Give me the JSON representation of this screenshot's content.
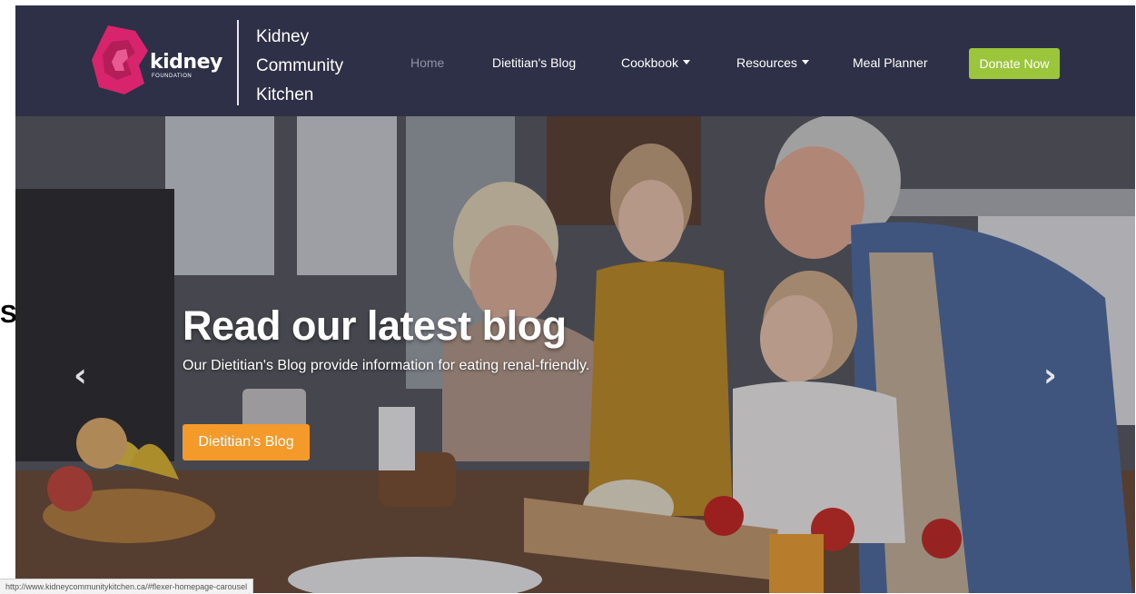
{
  "logo": {
    "word": "kidney",
    "sub": "FOUNDATION",
    "mark_color": "#d8246c"
  },
  "brand": {
    "line1": "Kidney",
    "line2": "Community",
    "line3": "Kitchen"
  },
  "nav": {
    "home": "Home",
    "blog": "Dietitian's Blog",
    "cookbook": "Cookbook",
    "resources": "Resources",
    "meal_planner": "Meal Planner",
    "donate": "Donate Now"
  },
  "hero": {
    "title": "Read our latest blog",
    "subtitle": "Our Dietitian's Blog provide information for eating renal-friendly.",
    "cta": "Dietitian's Blog",
    "prev_icon": "chevron-left-icon",
    "next_icon": "chevron-right-icon"
  },
  "status_url": "http://www.kidneycommunitykitchen.ca/#flexer-homepage-carousel",
  "colors": {
    "nav_bg": "#2d3047",
    "donate": "#9bc63b",
    "cta": "#f39a2a",
    "home_dim": "#8f93a6"
  }
}
